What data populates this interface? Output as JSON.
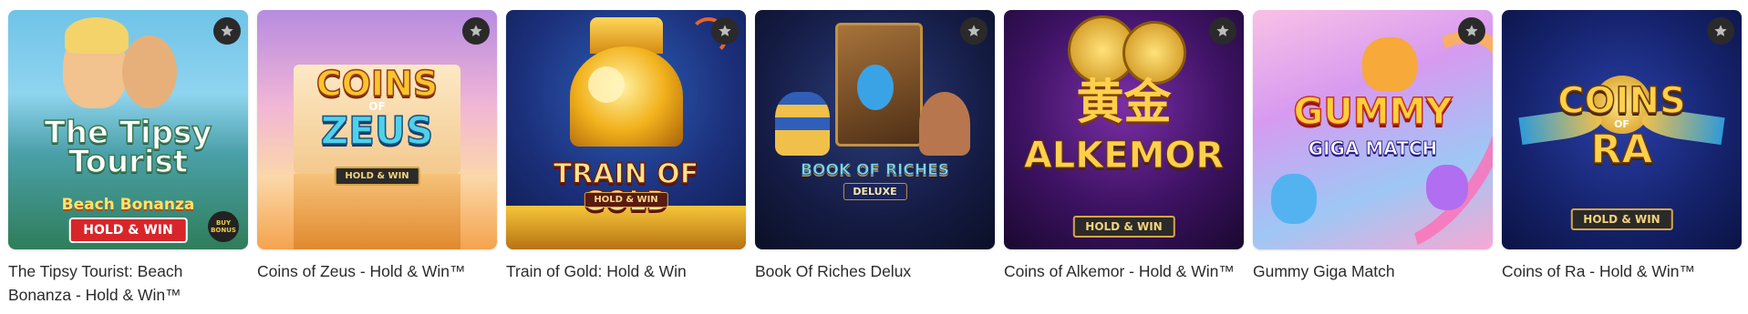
{
  "games": [
    {
      "title": "The Tipsy Tourist: Beach Bonanza - Hold & Win™",
      "art": {
        "line1": "The Tipsy",
        "line2": "Tourist",
        "sub": "Beach Bonanza",
        "badge": "HOLD & WIN",
        "corner": "BUY BONUS"
      },
      "favorite_icon": "star-icon"
    },
    {
      "title": "Coins of Zeus - Hold & Win™",
      "art": {
        "line1": "COINS",
        "line2": "ZEUS",
        "small": "OF",
        "badge": "HOLD & WIN"
      },
      "favorite_icon": "star-icon"
    },
    {
      "title": "Train of Gold: Hold & Win",
      "art": {
        "line1": "TRAIN OF GOLD",
        "badge": "HOLD & WIN"
      },
      "favorite_icon": "star-icon"
    },
    {
      "title": "Book Of Riches Delux",
      "art": {
        "line1": "BOOK OF RICHES",
        "badge": "DELUXE"
      },
      "favorite_icon": "star-icon"
    },
    {
      "title": "Coins of Alkemor - Hold & Win™",
      "art": {
        "line1": "黄金",
        "line2": "ALKEMOR",
        "badge": "HOLD & WIN"
      },
      "favorite_icon": "star-icon"
    },
    {
      "title": "Gummy Giga Match",
      "art": {
        "line1": "GUMMY",
        "line2": "GIGA MATCH"
      },
      "favorite_icon": "star-icon"
    },
    {
      "title": "Coins of Ra - Hold & Win™",
      "art": {
        "line1": "COINS",
        "small": "OF",
        "line2": "RA",
        "badge": "HOLD & WIN"
      },
      "favorite_icon": "star-icon"
    }
  ],
  "colors": {
    "title_text": "#2b2b2b",
    "favorite_bg": "#2a2a2a",
    "favorite_star": "#bdbdbd"
  }
}
